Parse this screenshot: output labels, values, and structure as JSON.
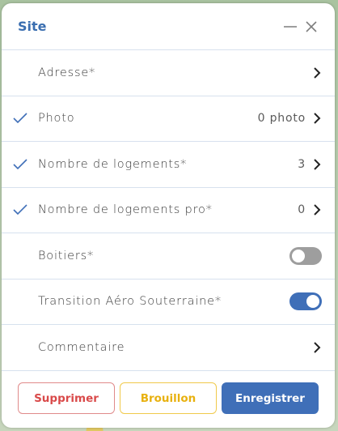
{
  "panel": {
    "title": "Site"
  },
  "rows": [
    {
      "label": "Adresse*",
      "checked": false,
      "value": "",
      "control": "chevron"
    },
    {
      "label": "Photo",
      "checked": true,
      "value": "0 photo",
      "control": "chevron"
    },
    {
      "label": "Nombre de logements*",
      "checked": true,
      "value": "3",
      "control": "chevron"
    },
    {
      "label": "Nombre de logements pro*",
      "checked": true,
      "value": "0",
      "control": "chevron"
    },
    {
      "label": "Boitiers*",
      "checked": false,
      "value": "",
      "control": "toggle-off"
    },
    {
      "label": "Transition Aéro Souterraine*",
      "checked": false,
      "value": "",
      "control": "toggle-on"
    },
    {
      "label": "Commentaire",
      "checked": false,
      "value": "",
      "control": "chevron"
    }
  ],
  "footer": {
    "delete_label": "Supprimer",
    "draft_label": "Brouillon",
    "save_label": "Enregistrer"
  },
  "colors": {
    "accent": "#3f6fb8",
    "danger": "#d94a4a",
    "warning": "#e8b10f"
  },
  "icons": {
    "minimize": "minimize-icon",
    "close": "close-icon",
    "check": "check-icon",
    "chevron": "chevron-right-icon"
  }
}
